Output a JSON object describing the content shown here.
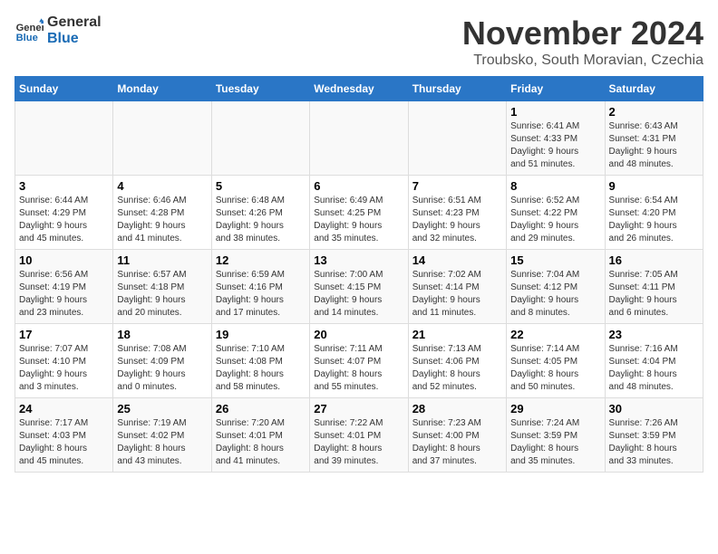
{
  "logo": {
    "line1": "General",
    "line2": "Blue"
  },
  "title": "November 2024",
  "subtitle": "Troubsko, South Moravian, Czechia",
  "weekdays": [
    "Sunday",
    "Monday",
    "Tuesday",
    "Wednesday",
    "Thursday",
    "Friday",
    "Saturday"
  ],
  "weeks": [
    [
      {
        "day": "",
        "detail": ""
      },
      {
        "day": "",
        "detail": ""
      },
      {
        "day": "",
        "detail": ""
      },
      {
        "day": "",
        "detail": ""
      },
      {
        "day": "",
        "detail": ""
      },
      {
        "day": "1",
        "detail": "Sunrise: 6:41 AM\nSunset: 4:33 PM\nDaylight: 9 hours\nand 51 minutes."
      },
      {
        "day": "2",
        "detail": "Sunrise: 6:43 AM\nSunset: 4:31 PM\nDaylight: 9 hours\nand 48 minutes."
      }
    ],
    [
      {
        "day": "3",
        "detail": "Sunrise: 6:44 AM\nSunset: 4:29 PM\nDaylight: 9 hours\nand 45 minutes."
      },
      {
        "day": "4",
        "detail": "Sunrise: 6:46 AM\nSunset: 4:28 PM\nDaylight: 9 hours\nand 41 minutes."
      },
      {
        "day": "5",
        "detail": "Sunrise: 6:48 AM\nSunset: 4:26 PM\nDaylight: 9 hours\nand 38 minutes."
      },
      {
        "day": "6",
        "detail": "Sunrise: 6:49 AM\nSunset: 4:25 PM\nDaylight: 9 hours\nand 35 minutes."
      },
      {
        "day": "7",
        "detail": "Sunrise: 6:51 AM\nSunset: 4:23 PM\nDaylight: 9 hours\nand 32 minutes."
      },
      {
        "day": "8",
        "detail": "Sunrise: 6:52 AM\nSunset: 4:22 PM\nDaylight: 9 hours\nand 29 minutes."
      },
      {
        "day": "9",
        "detail": "Sunrise: 6:54 AM\nSunset: 4:20 PM\nDaylight: 9 hours\nand 26 minutes."
      }
    ],
    [
      {
        "day": "10",
        "detail": "Sunrise: 6:56 AM\nSunset: 4:19 PM\nDaylight: 9 hours\nand 23 minutes."
      },
      {
        "day": "11",
        "detail": "Sunrise: 6:57 AM\nSunset: 4:18 PM\nDaylight: 9 hours\nand 20 minutes."
      },
      {
        "day": "12",
        "detail": "Sunrise: 6:59 AM\nSunset: 4:16 PM\nDaylight: 9 hours\nand 17 minutes."
      },
      {
        "day": "13",
        "detail": "Sunrise: 7:00 AM\nSunset: 4:15 PM\nDaylight: 9 hours\nand 14 minutes."
      },
      {
        "day": "14",
        "detail": "Sunrise: 7:02 AM\nSunset: 4:14 PM\nDaylight: 9 hours\nand 11 minutes."
      },
      {
        "day": "15",
        "detail": "Sunrise: 7:04 AM\nSunset: 4:12 PM\nDaylight: 9 hours\nand 8 minutes."
      },
      {
        "day": "16",
        "detail": "Sunrise: 7:05 AM\nSunset: 4:11 PM\nDaylight: 9 hours\nand 6 minutes."
      }
    ],
    [
      {
        "day": "17",
        "detail": "Sunrise: 7:07 AM\nSunset: 4:10 PM\nDaylight: 9 hours\nand 3 minutes."
      },
      {
        "day": "18",
        "detail": "Sunrise: 7:08 AM\nSunset: 4:09 PM\nDaylight: 9 hours\nand 0 minutes."
      },
      {
        "day": "19",
        "detail": "Sunrise: 7:10 AM\nSunset: 4:08 PM\nDaylight: 8 hours\nand 58 minutes."
      },
      {
        "day": "20",
        "detail": "Sunrise: 7:11 AM\nSunset: 4:07 PM\nDaylight: 8 hours\nand 55 minutes."
      },
      {
        "day": "21",
        "detail": "Sunrise: 7:13 AM\nSunset: 4:06 PM\nDaylight: 8 hours\nand 52 minutes."
      },
      {
        "day": "22",
        "detail": "Sunrise: 7:14 AM\nSunset: 4:05 PM\nDaylight: 8 hours\nand 50 minutes."
      },
      {
        "day": "23",
        "detail": "Sunrise: 7:16 AM\nSunset: 4:04 PM\nDaylight: 8 hours\nand 48 minutes."
      }
    ],
    [
      {
        "day": "24",
        "detail": "Sunrise: 7:17 AM\nSunset: 4:03 PM\nDaylight: 8 hours\nand 45 minutes."
      },
      {
        "day": "25",
        "detail": "Sunrise: 7:19 AM\nSunset: 4:02 PM\nDaylight: 8 hours\nand 43 minutes."
      },
      {
        "day": "26",
        "detail": "Sunrise: 7:20 AM\nSunset: 4:01 PM\nDaylight: 8 hours\nand 41 minutes."
      },
      {
        "day": "27",
        "detail": "Sunrise: 7:22 AM\nSunset: 4:01 PM\nDaylight: 8 hours\nand 39 minutes."
      },
      {
        "day": "28",
        "detail": "Sunrise: 7:23 AM\nSunset: 4:00 PM\nDaylight: 8 hours\nand 37 minutes."
      },
      {
        "day": "29",
        "detail": "Sunrise: 7:24 AM\nSunset: 3:59 PM\nDaylight: 8 hours\nand 35 minutes."
      },
      {
        "day": "30",
        "detail": "Sunrise: 7:26 AM\nSunset: 3:59 PM\nDaylight: 8 hours\nand 33 minutes."
      }
    ]
  ]
}
